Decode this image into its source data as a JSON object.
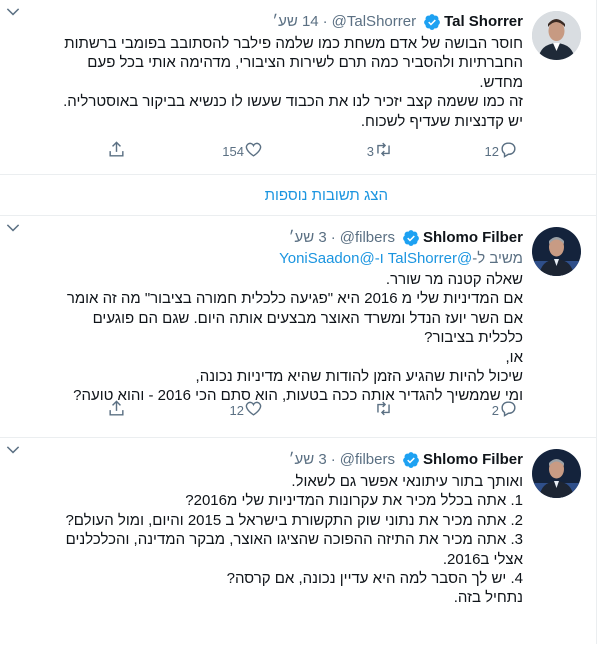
{
  "tweets": [
    {
      "name": "Tal Shorrer",
      "handle": "@TalShorrer",
      "time": "14 שע׳",
      "text": "חוסר הבושה של אדם משחת כמו שלמה פילבר להסתובב בפומבי ברשתות\nהחברתיות ולהסביר כמה תרם לשירות הציבורי, מדהימה אותי בכל פעם\nמחדש.\nזה כמו ששמה קצב יזכיר לנו את הכבוד שעשו לו כנשיא בביקור באוסטרליה.\nיש קדנציות שעדיף לשכוח.",
      "replies": "12",
      "retweets": "3",
      "likes": "154"
    },
    {
      "name": "Shlomo Filber",
      "handle": "@filbers",
      "time": "3 שע׳",
      "reply_to_prefix": "משיב ל-",
      "reply_to_links": "@TalShorrer ו-@YoniSaadon",
      "text": "שאלה קטנה מר שורר.\nאם המדיניות שלי מ 2016 היא \"פגיעה כלכלית חמורה בציבור\" מה זה אומר\nאם השר יועז הנדל ומשרד האוצר מבצעים אותה היום. שגם הם פוגעים\nכלכלית בציבור?\nאו,\nשיכול להיות שהגיע הזמן להודות שהיא מדיניות נכונה,\nומי שממשיך להגדיר אותה ככה בטעות, הוא סתם הכי 2016 - והוא טועה?",
      "replies": "2",
      "retweets": "",
      "likes": "12"
    },
    {
      "name": "Shlomo Filber",
      "handle": "@filbers",
      "time": "3 שע׳",
      "text": "ואותך בתור עיתונאי אפשר גם לשאול.\n1. אתה בכלל מכיר את עקרונות המדיניות שלי מ2016?\n2. אתה מכיר את נתוני שוק התקשורת בישראל ב 2015 והיום, ומול העולם?\n3. אתה מכיר את התיזה ההפוכה שהציגו האוצר, מבקר המדינה, והכלכלנים\nאצלי ב2016.\n4. יש לך הסבר למה היא עדיין נכונה, אם קרסה?\nנתחיל בזה."
    }
  ],
  "show_more": "הצג תשובות נוספות",
  "colors": {
    "accent": "#1b95e0",
    "secondary_text": "#5b7083",
    "divider": "#ebeef0"
  },
  "icons": [
    "verified-icon",
    "caret-down-icon",
    "reply-icon",
    "retweet-icon",
    "like-icon",
    "share-icon"
  ]
}
